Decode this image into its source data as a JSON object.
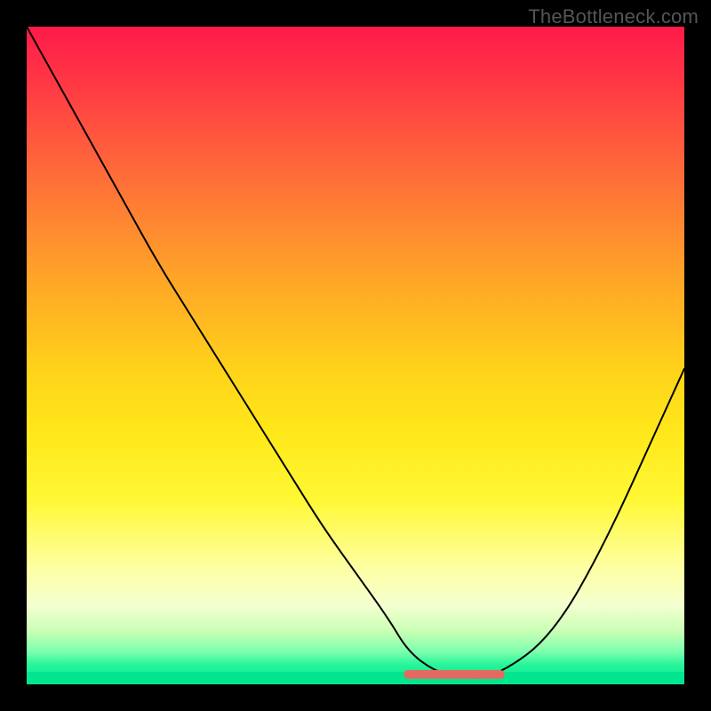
{
  "watermark": "TheBottleneck.com",
  "colors": {
    "curve": "#000000",
    "marker": "#e46a60",
    "bg_black": "#000000"
  },
  "chart_data": {
    "type": "line",
    "title": "",
    "xlabel": "",
    "ylabel": "",
    "xlim": [
      0,
      100
    ],
    "ylim": [
      0,
      100
    ],
    "x": [
      0,
      5,
      10,
      15,
      20,
      25,
      30,
      35,
      40,
      45,
      50,
      55,
      58,
      62,
      66,
      70,
      74,
      78,
      82,
      86,
      90,
      95,
      100
    ],
    "values": [
      100,
      91,
      82,
      73,
      64,
      56,
      48,
      40,
      32,
      24,
      17,
      10,
      5,
      2,
      1,
      1,
      3,
      6,
      11,
      18,
      26,
      37,
      48
    ],
    "minimum_band_x": [
      58,
      72
    ],
    "minimum_band_y": 1.5,
    "notes": "V-shaped curve over rainbow heat gradient; curve values are approximate percent height from bottom. A short red marker segment sits near the curve minimum."
  }
}
